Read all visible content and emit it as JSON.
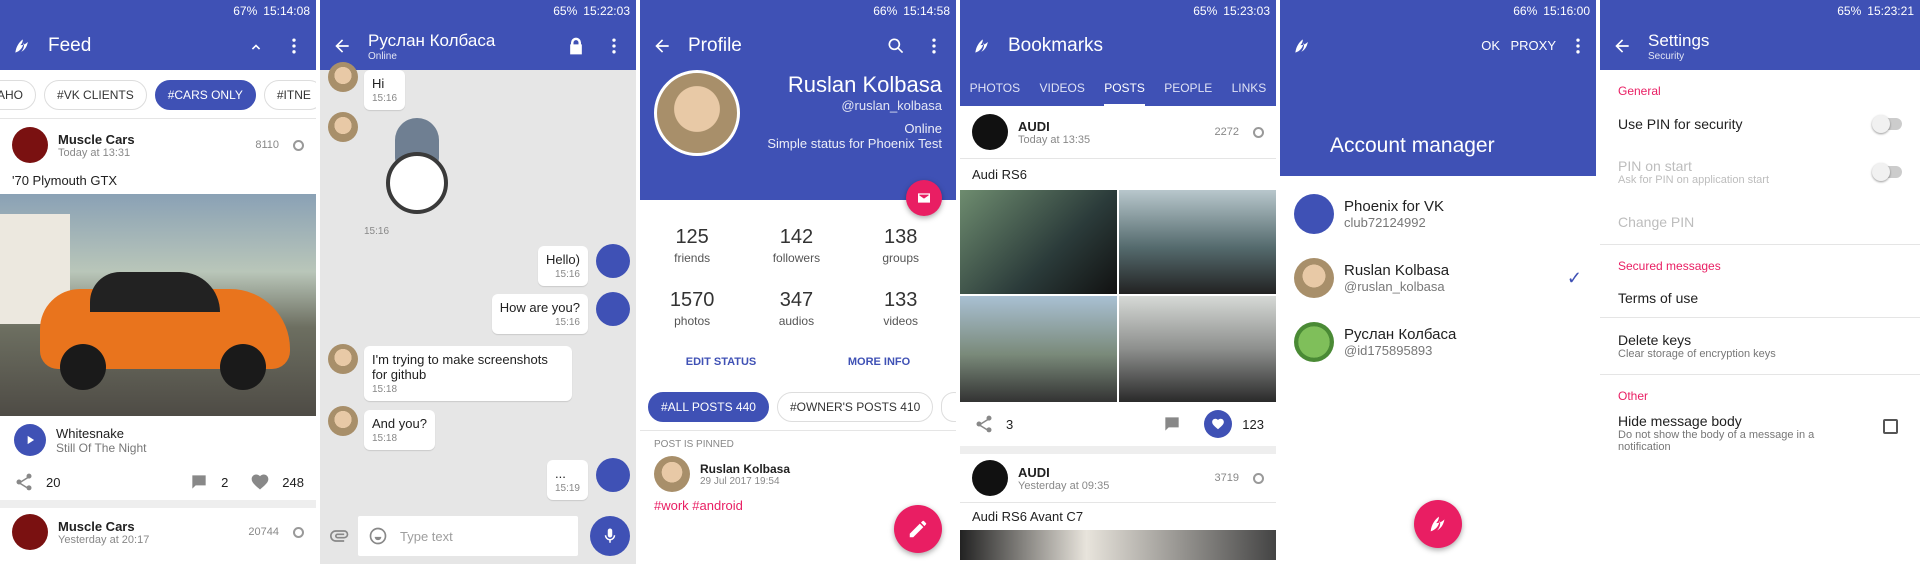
{
  "screens": {
    "feed": {
      "status": {
        "battery": "67%",
        "time": "15:14:08"
      },
      "title": "Feed",
      "chips": [
        "AHO",
        "#VK CLIENTS",
        "#CARS ONLY",
        "#ITNE"
      ],
      "post1": {
        "author": "Muscle Cars",
        "date": "Today at 13:31",
        "views": "8110",
        "text": "'70 Plymouth GTX",
        "audio_artist": "Whitesnake",
        "audio_title": "Still Of The Night",
        "reposts": "20",
        "comments": "2",
        "likes": "248"
      },
      "post2": {
        "author": "Muscle Cars",
        "date": "Yesterday at 20:17",
        "views": "20744"
      }
    },
    "chat": {
      "status": {
        "battery": "65%",
        "time": "15:22:03"
      },
      "title": "Руслан Колбаса",
      "subtitle": "Online",
      "messages": [
        {
          "text": "Hi",
          "time": "15:16"
        },
        {
          "text": "",
          "time": "15:16"
        },
        {
          "text": "Hello)",
          "time": "15:16"
        },
        {
          "text": "How are you?",
          "time": "15:16"
        },
        {
          "text": "I'm trying to make screenshots for github",
          "time": "15:18"
        },
        {
          "text": "And you?",
          "time": "15:18"
        },
        {
          "text": "...",
          "time": "15:19"
        }
      ],
      "input_placeholder": "Type text"
    },
    "profile": {
      "status": {
        "battery": "66%",
        "time": "15:14:58"
      },
      "title": "Profile",
      "name": "Ruslan Kolbasa",
      "domain": "@ruslan_kolbasa",
      "online": "Online",
      "status_text": "Simple status for Phoenix Test",
      "stats": [
        {
          "value": "125",
          "label": "friends"
        },
        {
          "value": "142",
          "label": "followers"
        },
        {
          "value": "138",
          "label": "groups"
        },
        {
          "value": "1570",
          "label": "photos"
        },
        {
          "value": "347",
          "label": "audios"
        },
        {
          "value": "133",
          "label": "videos"
        }
      ],
      "edit_status": "EDIT STATUS",
      "more_info": "MORE INFO",
      "chip_all": "#ALL POSTS 440",
      "chip_owner": "#OWNER'S POSTS 410",
      "pinned_label": "POST IS PINNED",
      "pinned_author": "Ruslan Kolbasa",
      "pinned_date": "29 Jul 2017 19:54",
      "hashtags": "#work #android"
    },
    "bookmarks": {
      "status": {
        "battery": "65%",
        "time": "15:23:03"
      },
      "title": "Bookmarks",
      "tabs": [
        "PHOTOS",
        "VIDEOS",
        "POSTS",
        "PEOPLE",
        "LINKS"
      ],
      "post1": {
        "author": "AUDI",
        "date": "Today at 13:35",
        "views": "2272",
        "text": "Audi RS6",
        "reposts": "3",
        "likes": "123"
      },
      "post2": {
        "author": "AUDI",
        "date": "Yesterday at 09:35",
        "views": "3719",
        "text": "Audi RS6 Avant C7"
      }
    },
    "accounts": {
      "status": {
        "battery": "66%",
        "time": "15:16:00"
      },
      "ok": "OK",
      "proxy": "PROXY",
      "title": "Account manager",
      "list": [
        {
          "name": "Phoenix for VK",
          "id": "club72124992"
        },
        {
          "name": "Ruslan Kolbasa",
          "id": "@ruslan_kolbasa"
        },
        {
          "name": "Руслан Колбаса",
          "id": "@id175895893"
        }
      ]
    },
    "settings": {
      "status": {
        "battery": "65%",
        "time": "15:23:21"
      },
      "title": "Settings",
      "subtitle": "Security",
      "general": "General",
      "use_pin": "Use PIN for security",
      "pin_on_start": "PIN on start",
      "pin_on_start_hint": "Ask for PIN on application start",
      "change_pin": "Change PIN",
      "secured": "Secured messages",
      "terms": "Terms of use",
      "delete_keys": "Delete keys",
      "delete_keys_hint": "Clear storage of encryption keys",
      "other": "Other",
      "hide_body": "Hide message body",
      "hide_body_hint": "Do not show the body of a message in a notification"
    }
  },
  "colors": {
    "primary": "#3f51b5",
    "accent": "#e91e63"
  }
}
